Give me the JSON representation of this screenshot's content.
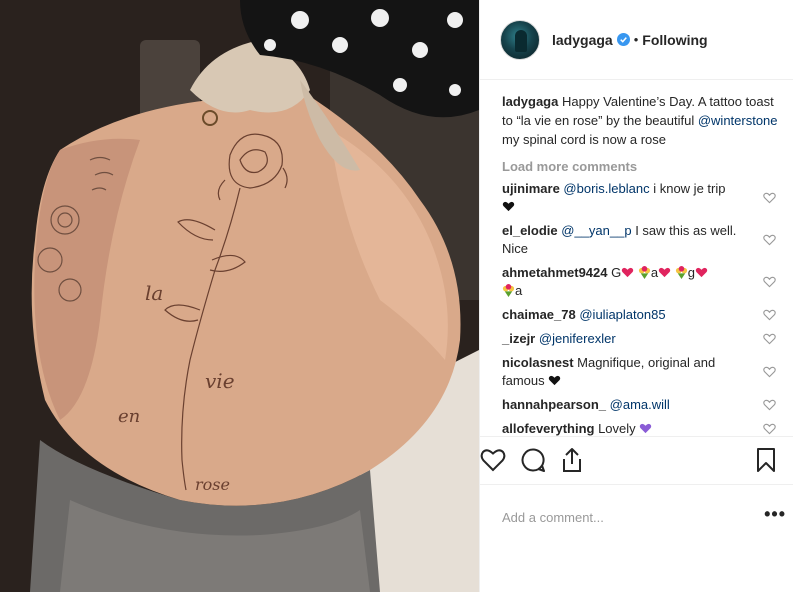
{
  "post": {
    "author": "ladygaga",
    "follow_status": "Following",
    "separator": "•",
    "caption_author": "ladygaga",
    "caption_text_1": " Happy Valentine’s Day. A tattoo toast to “la vie en rose” by the beautiful ",
    "caption_mention": "@winterstone",
    "caption_text_2": " my spinal cord is now a rose"
  },
  "load_more": "Load more comments",
  "comments": [
    {
      "user": "ujinimare",
      "mention": "@boris.leblanc",
      "text": " i know je trip"
    },
    {
      "user": "el_elodie",
      "mention": "@__yan__p",
      "text": " I saw this as well. Nice"
    },
    {
      "user": "ahmetahmet9424",
      "text": " G",
      "t2": "a",
      "t3": "g",
      "t4": "a"
    },
    {
      "user": "chaimae_78",
      "mention": "@iuliaplaton85"
    },
    {
      "user": "_izejr",
      "mention": "@jeniferexler"
    },
    {
      "user": "nicolasnest",
      "text": " Magnifique, original and famous "
    },
    {
      "user": "hannahpearson_",
      "mention": "@ama.will"
    },
    {
      "user": "allofeverything",
      "text": " Lovely "
    }
  ],
  "add_comment_placeholder": "Add a comment...",
  "more_options": "•••",
  "photo_text": {
    "word1": "la",
    "word2": "vie",
    "word3": "en",
    "word4": "rose"
  },
  "colors": {
    "verified": "#3897f0",
    "mention": "#003569",
    "muted": "#999999",
    "heart_red": "#e0245e",
    "purple_heart": "#8a5cd6"
  },
  "icons": {
    "like": "heart-outline-icon",
    "comment": "speech-bubble-icon",
    "share": "share-icon",
    "save": "bookmark-icon"
  }
}
